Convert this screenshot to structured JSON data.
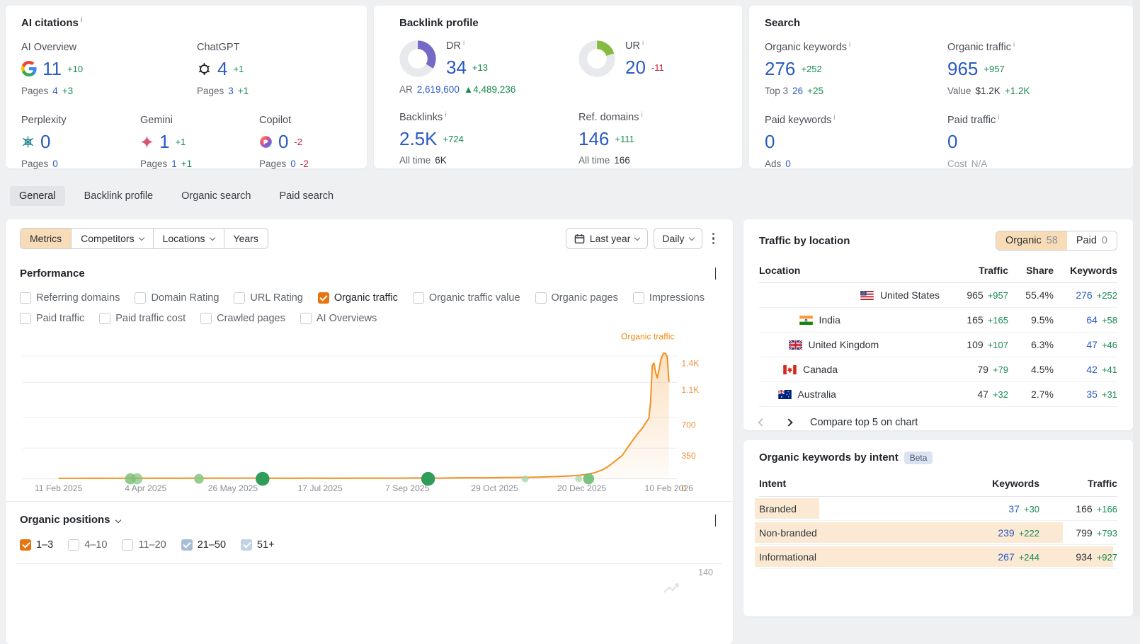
{
  "ai": {
    "title": "AI citations",
    "row1": [
      {
        "icon": "google",
        "label": "AI Overview",
        "value": "11",
        "delta": "+10",
        "pages_label": "Pages",
        "pages": "4",
        "pages_delta": "+3"
      },
      {
        "icon": "chatgpt",
        "label": "ChatGPT",
        "value": "4",
        "delta": "+1",
        "pages_label": "Pages",
        "pages": "3",
        "pages_delta": "+1"
      }
    ],
    "row2": [
      {
        "icon": "perplexity",
        "label": "Perplexity",
        "value": "0",
        "delta": "",
        "pages_label": "Pages",
        "pages": "0",
        "pages_delta": ""
      },
      {
        "icon": "gemini",
        "label": "Gemini",
        "value": "1",
        "delta": "+1",
        "pages_label": "Pages",
        "pages": "1",
        "pages_delta": "+1"
      },
      {
        "icon": "copilot",
        "label": "Copilot",
        "value": "0",
        "delta": "-2",
        "pages_label": "Pages",
        "pages": "0",
        "pages_delta": "-2"
      }
    ]
  },
  "backlink": {
    "title": "Backlink profile",
    "dr": {
      "label": "DR",
      "value": "34",
      "delta": "+13",
      "pct": 34,
      "color": "#7468c8"
    },
    "ur": {
      "label": "UR",
      "value": "20",
      "delta": "-11",
      "pct": 20,
      "color": "#85bb3e"
    },
    "ar": {
      "label": "AR",
      "value": "2,619,600",
      "arrow": "▲",
      "delta": "4,489,236"
    },
    "backlinks": {
      "label": "Backlinks",
      "value": "2.5K",
      "delta": "+724",
      "sub_label": "All time",
      "sub_value": "6K"
    },
    "refdomains": {
      "label": "Ref. domains",
      "value": "146",
      "delta": "+111",
      "sub_label": "All time",
      "sub_value": "166"
    }
  },
  "search": {
    "title": "Search",
    "cells": [
      {
        "label": "Organic keywords",
        "value": "276",
        "delta": "+252",
        "sub": [
          {
            "t": "Top 3",
            "c": "gray"
          },
          {
            "t": "26",
            "c": "blue"
          },
          {
            "t": "+25",
            "c": "green"
          }
        ]
      },
      {
        "label": "Organic traffic",
        "value": "965",
        "delta": "+957",
        "sub": [
          {
            "t": "Value",
            "c": "gray"
          },
          {
            "t": "$1.2K",
            "c": "dark"
          },
          {
            "t": "+1.2K",
            "c": "green"
          }
        ]
      },
      {
        "label": "Paid keywords",
        "value": "0",
        "delta": "",
        "sub": [
          {
            "t": "Ads",
            "c": "gray"
          },
          {
            "t": "0",
            "c": "blue"
          }
        ]
      },
      {
        "label": "Paid traffic",
        "value": "0",
        "delta": "",
        "sub": [
          {
            "t": "Cost",
            "c": "lightgray"
          },
          {
            "t": "N/A",
            "c": "lightgray"
          }
        ]
      }
    ]
  },
  "tabs": [
    {
      "label": "General",
      "active": true
    },
    {
      "label": "Backlink profile",
      "active": false
    },
    {
      "label": "Organic search",
      "active": false
    },
    {
      "label": "Paid search",
      "active": false
    }
  ],
  "toolbar": {
    "segments": [
      {
        "label": "Metrics",
        "active": true,
        "chevron": false
      },
      {
        "label": "Competitors",
        "active": false,
        "chevron": true
      },
      {
        "label": "Locations",
        "active": false,
        "chevron": true
      },
      {
        "label": "Years",
        "active": false,
        "chevron": false
      }
    ],
    "period_label": "Last year",
    "granularity_label": "Daily"
  },
  "performance": {
    "title": "Performance",
    "metrics": [
      {
        "label": "Referring domains",
        "checked": false
      },
      {
        "label": "Domain Rating",
        "checked": false
      },
      {
        "label": "URL Rating",
        "checked": false
      },
      {
        "label": "Organic traffic",
        "checked": true,
        "color": "#e8740e"
      },
      {
        "label": "Organic traffic value",
        "checked": false
      },
      {
        "label": "Organic pages",
        "checked": false
      },
      {
        "label": "Impressions",
        "checked": false
      },
      {
        "label": "Paid traffic",
        "checked": false
      },
      {
        "label": "Paid traffic cost",
        "checked": false
      },
      {
        "label": "Crawled pages",
        "checked": false
      },
      {
        "label": "AI Overviews",
        "checked": false
      }
    ]
  },
  "positions": {
    "title": "Organic positions",
    "filters": [
      {
        "label": "1–3",
        "checked": true,
        "color": "#e8740e"
      },
      {
        "label": "4–10",
        "checked": false
      },
      {
        "label": "11–20",
        "checked": false
      },
      {
        "label": "21–50",
        "checked": true,
        "color": "#a7bed3"
      },
      {
        "label": "51+",
        "checked": true,
        "color": "#c3d3e1"
      }
    ],
    "y_top_label": "140"
  },
  "locations": {
    "title": "Traffic by location",
    "toggle": [
      {
        "label": "Organic",
        "count": "58",
        "active": true
      },
      {
        "label": "Paid",
        "count": "0",
        "active": false
      }
    ],
    "columns": [
      "Location",
      "Traffic",
      "Share",
      "Keywords"
    ],
    "rows": [
      {
        "flag": "us",
        "name": "United States",
        "traffic": "965",
        "traffic_delta": "+957",
        "share": "55.4%",
        "keywords": "276",
        "kw_delta": "+252",
        "bar": 100
      },
      {
        "flag": "in",
        "name": "India",
        "traffic": "165",
        "traffic_delta": "+165",
        "share": "9.5%",
        "keywords": "64",
        "kw_delta": "+58",
        "bar": 17
      },
      {
        "flag": "gb",
        "name": "United Kingdom",
        "traffic": "109",
        "traffic_delta": "+107",
        "share": "6.3%",
        "keywords": "47",
        "kw_delta": "+46",
        "bar": 11
      },
      {
        "flag": "ca",
        "name": "Canada",
        "traffic": "79",
        "traffic_delta": "+79",
        "share": "4.5%",
        "keywords": "42",
        "kw_delta": "+41",
        "bar": 8
      },
      {
        "flag": "au",
        "name": "Australia",
        "traffic": "47",
        "traffic_delta": "+32",
        "share": "2.7%",
        "keywords": "35",
        "kw_delta": "+31",
        "bar": 5
      }
    ],
    "pager_label": "Compare top 5 on chart"
  },
  "intent": {
    "title": "Organic keywords by intent",
    "badge": "Beta",
    "columns": [
      "Intent",
      "Keywords",
      "Traffic"
    ],
    "rows": [
      {
        "name": "Branded",
        "keywords": "37",
        "kw_delta": "+30",
        "traffic": "166",
        "tr_delta": "+166",
        "bar": 18
      },
      {
        "name": "Non-branded",
        "keywords": "239",
        "kw_delta": "+222",
        "traffic": "799",
        "tr_delta": "+793",
        "bar": 86
      },
      {
        "name": "Informational",
        "keywords": "267",
        "kw_delta": "+244",
        "traffic": "934",
        "tr_delta": "+927",
        "bar": 100
      }
    ]
  },
  "chart_data": {
    "type": "area",
    "title": "Organic traffic",
    "legend_position": "top-right",
    "grid": "horizontal",
    "x_range_days": 365,
    "x_ticks": [
      "11 Feb 2025",
      "4 Apr 2025",
      "26 May 2025",
      "17 Jul 2025",
      "7 Sep 2025",
      "29 Oct 2025",
      "20 Dec 2025",
      "10 Feb 2026"
    ],
    "y_ticks": [
      "0",
      "350",
      "700",
      "1.1K",
      "1.4K"
    ],
    "y_tick_values": [
      0,
      350,
      700,
      1100,
      1400
    ],
    "ylim": [
      0,
      1450
    ],
    "series": [
      {
        "name": "Organic traffic",
        "color": "#f2901d",
        "points": [
          [
            0,
            6
          ],
          [
            12,
            6
          ],
          [
            24,
            7
          ],
          [
            36,
            6
          ],
          [
            44,
            8
          ],
          [
            52,
            7
          ],
          [
            62,
            8
          ],
          [
            72,
            7
          ],
          [
            85,
            8
          ],
          [
            98,
            8
          ],
          [
            110,
            9
          ],
          [
            122,
            9
          ],
          [
            136,
            7
          ],
          [
            150,
            8
          ],
          [
            164,
            7
          ],
          [
            178,
            8
          ],
          [
            192,
            8
          ],
          [
            206,
            9
          ],
          [
            214,
            10
          ],
          [
            228,
            9
          ],
          [
            242,
            12
          ],
          [
            256,
            12
          ],
          [
            264,
            14
          ],
          [
            272,
            16
          ],
          [
            280,
            17
          ],
          [
            287,
            20
          ],
          [
            294,
            24
          ],
          [
            300,
            28
          ],
          [
            306,
            33
          ],
          [
            312,
            42
          ],
          [
            317,
            55
          ],
          [
            321,
            72
          ],
          [
            325,
            100
          ],
          [
            329,
            145
          ],
          [
            333,
            205
          ],
          [
            337,
            265
          ],
          [
            340,
            350
          ],
          [
            343,
            430
          ],
          [
            346,
            510
          ],
          [
            349,
            575
          ],
          [
            351,
            635
          ],
          [
            353,
            690
          ],
          [
            354,
            880
          ],
          [
            355,
            1290
          ],
          [
            356,
            1320
          ],
          [
            357,
            1215
          ],
          [
            358,
            1150
          ],
          [
            359,
            1235
          ],
          [
            360,
            1350
          ],
          [
            361,
            1400
          ],
          [
            362,
            1435
          ],
          [
            363,
            1425
          ],
          [
            364,
            1390
          ],
          [
            365,
            1105
          ]
        ]
      }
    ],
    "annotations": [
      {
        "day": 43,
        "r": 8,
        "color": "#7fc079",
        "opacity": 0.85
      },
      {
        "day": 47,
        "r": 8,
        "color": "#7fc079",
        "opacity": 0.7
      },
      {
        "day": 84,
        "r": 7,
        "color": "#8cc884",
        "opacity": 0.9
      },
      {
        "day": 122,
        "r": 10,
        "color": "#2f9c59",
        "opacity": 1
      },
      {
        "day": 221,
        "r": 10,
        "color": "#2f9c59",
        "opacity": 1
      },
      {
        "day": 279,
        "r": 5,
        "color": "#a8d6a2",
        "opacity": 0.8
      },
      {
        "day": 311,
        "r": 5,
        "color": "#a8d6a2",
        "opacity": 0.7
      },
      {
        "day": 317,
        "r": 8,
        "color": "#6dbd70",
        "opacity": 0.9
      }
    ]
  }
}
